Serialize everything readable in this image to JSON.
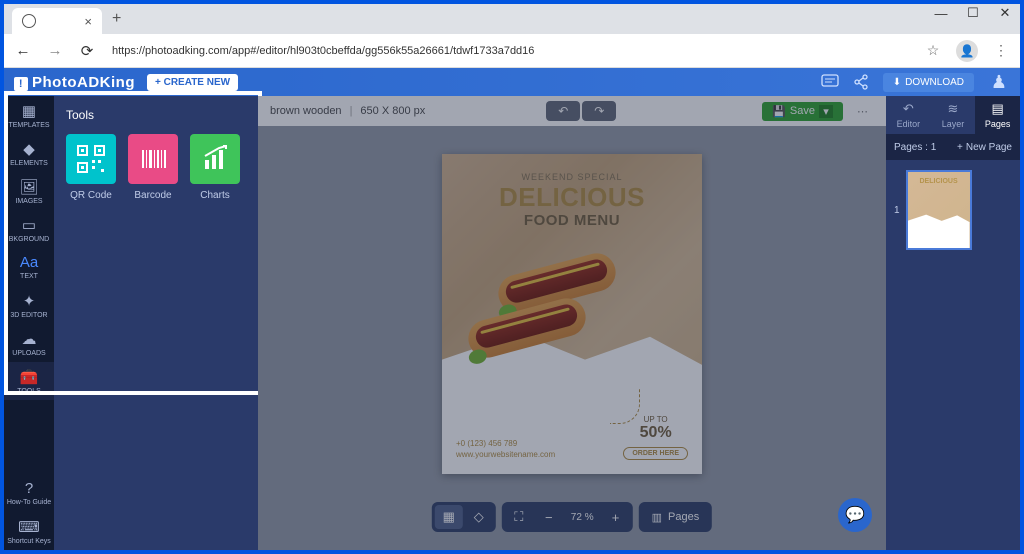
{
  "browser": {
    "url": "https://photoadking.com/app#/editor/hl903t0cbeffda/gg556k55a26661/tdwf1733a7dd16"
  },
  "window_controls": {
    "min": "—",
    "max": "☐",
    "close": "✕"
  },
  "header": {
    "logo": "PhotoADKing",
    "create_new": "+ CREATE NEW",
    "download": "DOWNLOAD"
  },
  "sidebar": {
    "items": [
      {
        "label": "TEMPLATES"
      },
      {
        "label": "ELEMENTS"
      },
      {
        "label": "IMAGES"
      },
      {
        "label": "BKGROUND"
      },
      {
        "label": "TEXT"
      },
      {
        "label": "3D EDITOR"
      },
      {
        "label": "UPLOADS"
      },
      {
        "label": "TOOLS"
      }
    ],
    "bottom": [
      {
        "label": "How-To Guide"
      },
      {
        "label": "Shortcut Keys"
      }
    ]
  },
  "tools_panel": {
    "title": "Tools",
    "items": [
      {
        "label": "QR Code"
      },
      {
        "label": "Barcode"
      },
      {
        "label": "Charts"
      }
    ]
  },
  "canvas_toolbar": {
    "bg_name": "brown wooden",
    "dimensions": "650 X 800 px",
    "save_label": "Save"
  },
  "design": {
    "subtitle": "WEEKEND SPECIAL",
    "title_big": "DELICIOUS",
    "title_sub": "FOOD MENU",
    "upto": "UP TO",
    "percent": "50%",
    "order": "ORDER HERE",
    "phone": "+0 (123) 456 789",
    "website": "www.yourwebsitename.com"
  },
  "bottom_toolbar": {
    "zoom": "72 %",
    "pages_label": "Pages"
  },
  "right_panel": {
    "tabs": [
      {
        "label": "Editor"
      },
      {
        "label": "Layer"
      },
      {
        "label": "Pages"
      }
    ],
    "pages_count": "Pages : 1",
    "new_page": "New Page",
    "thumb_num": "1"
  }
}
